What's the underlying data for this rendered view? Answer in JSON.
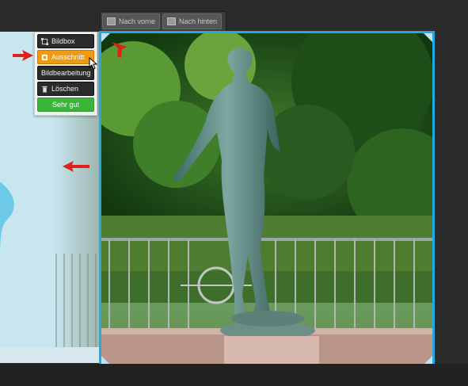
{
  "toolbar": {
    "bring_forward_label": "Nach vorne",
    "send_backward_label": "Nach hinten"
  },
  "context_menu": {
    "items": [
      {
        "label": "Bildbox",
        "icon": "crop-frame-icon",
        "state": "normal"
      },
      {
        "label": "Ausschnitt",
        "icon": "crop-icon",
        "state": "active"
      },
      {
        "label": "Bildbearbeitung",
        "icon": "",
        "state": "normal"
      },
      {
        "label": "Löschen",
        "icon": "trash-icon",
        "state": "normal"
      }
    ],
    "confirm_label": "Sehr gut"
  },
  "colors": {
    "frame_border": "#27a7e0",
    "active_item": "#ef9a10",
    "confirm_button": "#3ab53a",
    "annotation_arrow": "#e0201c",
    "page_background": "#c7e6ef"
  },
  "image": {
    "subject": "green statue in park"
  }
}
